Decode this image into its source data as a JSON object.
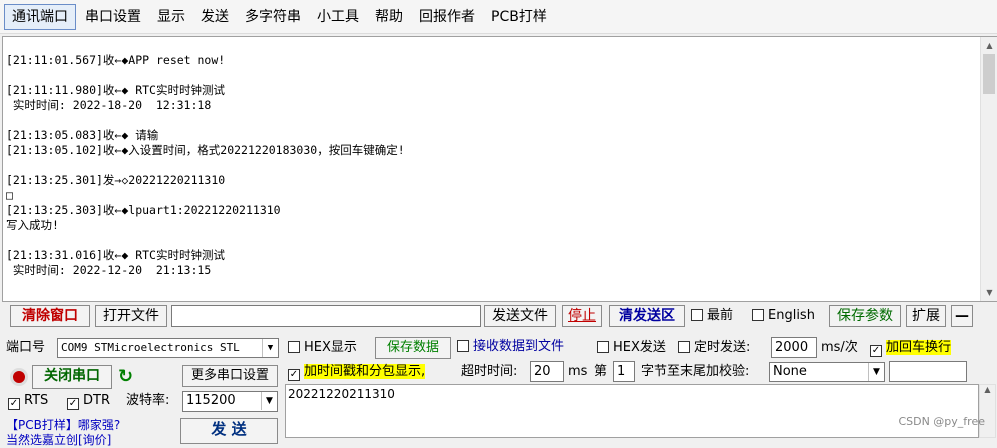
{
  "menu": {
    "items": [
      "通讯端口",
      "串口设置",
      "显示",
      "发送",
      "多字符串",
      "小工具",
      "帮助",
      "回报作者",
      "PCB打样"
    ]
  },
  "receive": {
    "text": "[21:11:01.567]收←◆APP reset now!\n\n[21:11:11.980]收←◆ RTC实时时钟测试\n 实时时间: 2022-18-20  12:31:18\n\n[21:13:05.083]收←◆ 请输\n[21:13:05.102]收←◆入设置时间，格式20221220183030，按回车键确定!\n\n[21:13:25.301]发→◇20221220211310\n□\n[21:13:25.303]收←◆lpuart1:20221220211310\n写入成功!\n\n[21:13:31.016]收←◆ RTC实时时钟测试\n 实时时间: 2022-12-20  21:13:15"
  },
  "toolbar": {
    "clear_window": "清除窗口",
    "open_file": "打开文件",
    "file_path": "",
    "send_file": "发送文件",
    "stop": "停止",
    "clear_send": "清发送区",
    "topmost": "最前",
    "english": "English",
    "save_params": "保存参数",
    "expand": "扩展",
    "minus": "—"
  },
  "port": {
    "port_label": "端口号",
    "port_value": "COM9 STMicroelectronics STL",
    "close_port": "关闭串口",
    "more_settings": "更多串口设置",
    "rts": "RTS",
    "dtr": "DTR",
    "baud_label": "波特率:",
    "baud_value": "115200",
    "promo_line1": "【PCB打样】哪家强?",
    "promo_line2": "当然选嘉立创[询价]",
    "send_button": "发  送"
  },
  "options": {
    "hex_display": "HEX显示",
    "save_data": "保存数据",
    "recv_to_file": "接收数据到文件",
    "hex_send": "HEX发送",
    "timed_send": "定时发送:",
    "interval": "2000",
    "interval_unit": "ms/次",
    "append_crlf": "加回车换行",
    "timestamp": "加时间戳和分包显示,",
    "timeout_label": "超时时间:",
    "timeout_value": "20",
    "timeout_unit": "ms",
    "byte_prefix": "第",
    "byte_index": "1",
    "checksum_label": "字节至末尾加校验:",
    "checksum_value": "None"
  },
  "send": {
    "text": "20221220211310"
  },
  "watermark": "CSDN @py_free"
}
